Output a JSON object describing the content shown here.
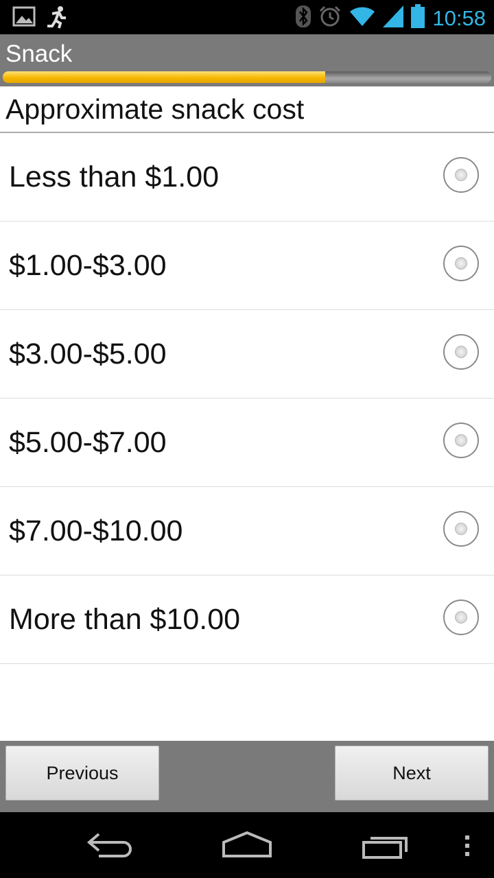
{
  "status_bar": {
    "time": "10:58",
    "left_icons": [
      "image-icon",
      "running-man-icon"
    ],
    "right_icons": [
      "bluetooth-icon",
      "alarm-icon",
      "wifi-icon",
      "signal-icon",
      "battery-icon"
    ],
    "accent_color": "#33b5e5"
  },
  "header": {
    "title": "Snack",
    "progress_fraction": 0.66
  },
  "question": {
    "text": "Approximate snack cost"
  },
  "options": [
    {
      "label": "Less than $1.00",
      "selected": false
    },
    {
      "label": "$1.00-$3.00",
      "selected": false
    },
    {
      "label": "$3.00-$5.00",
      "selected": false
    },
    {
      "label": "$5.00-$7.00",
      "selected": false
    },
    {
      "label": "$7.00-$10.00",
      "selected": false
    },
    {
      "label": "More than $10.00",
      "selected": false
    }
  ],
  "footer": {
    "previous_label": "Previous",
    "next_label": "Next"
  },
  "nav_bar": {
    "icons": [
      "back-icon",
      "home-icon",
      "recent-apps-icon",
      "menu-icon"
    ]
  }
}
